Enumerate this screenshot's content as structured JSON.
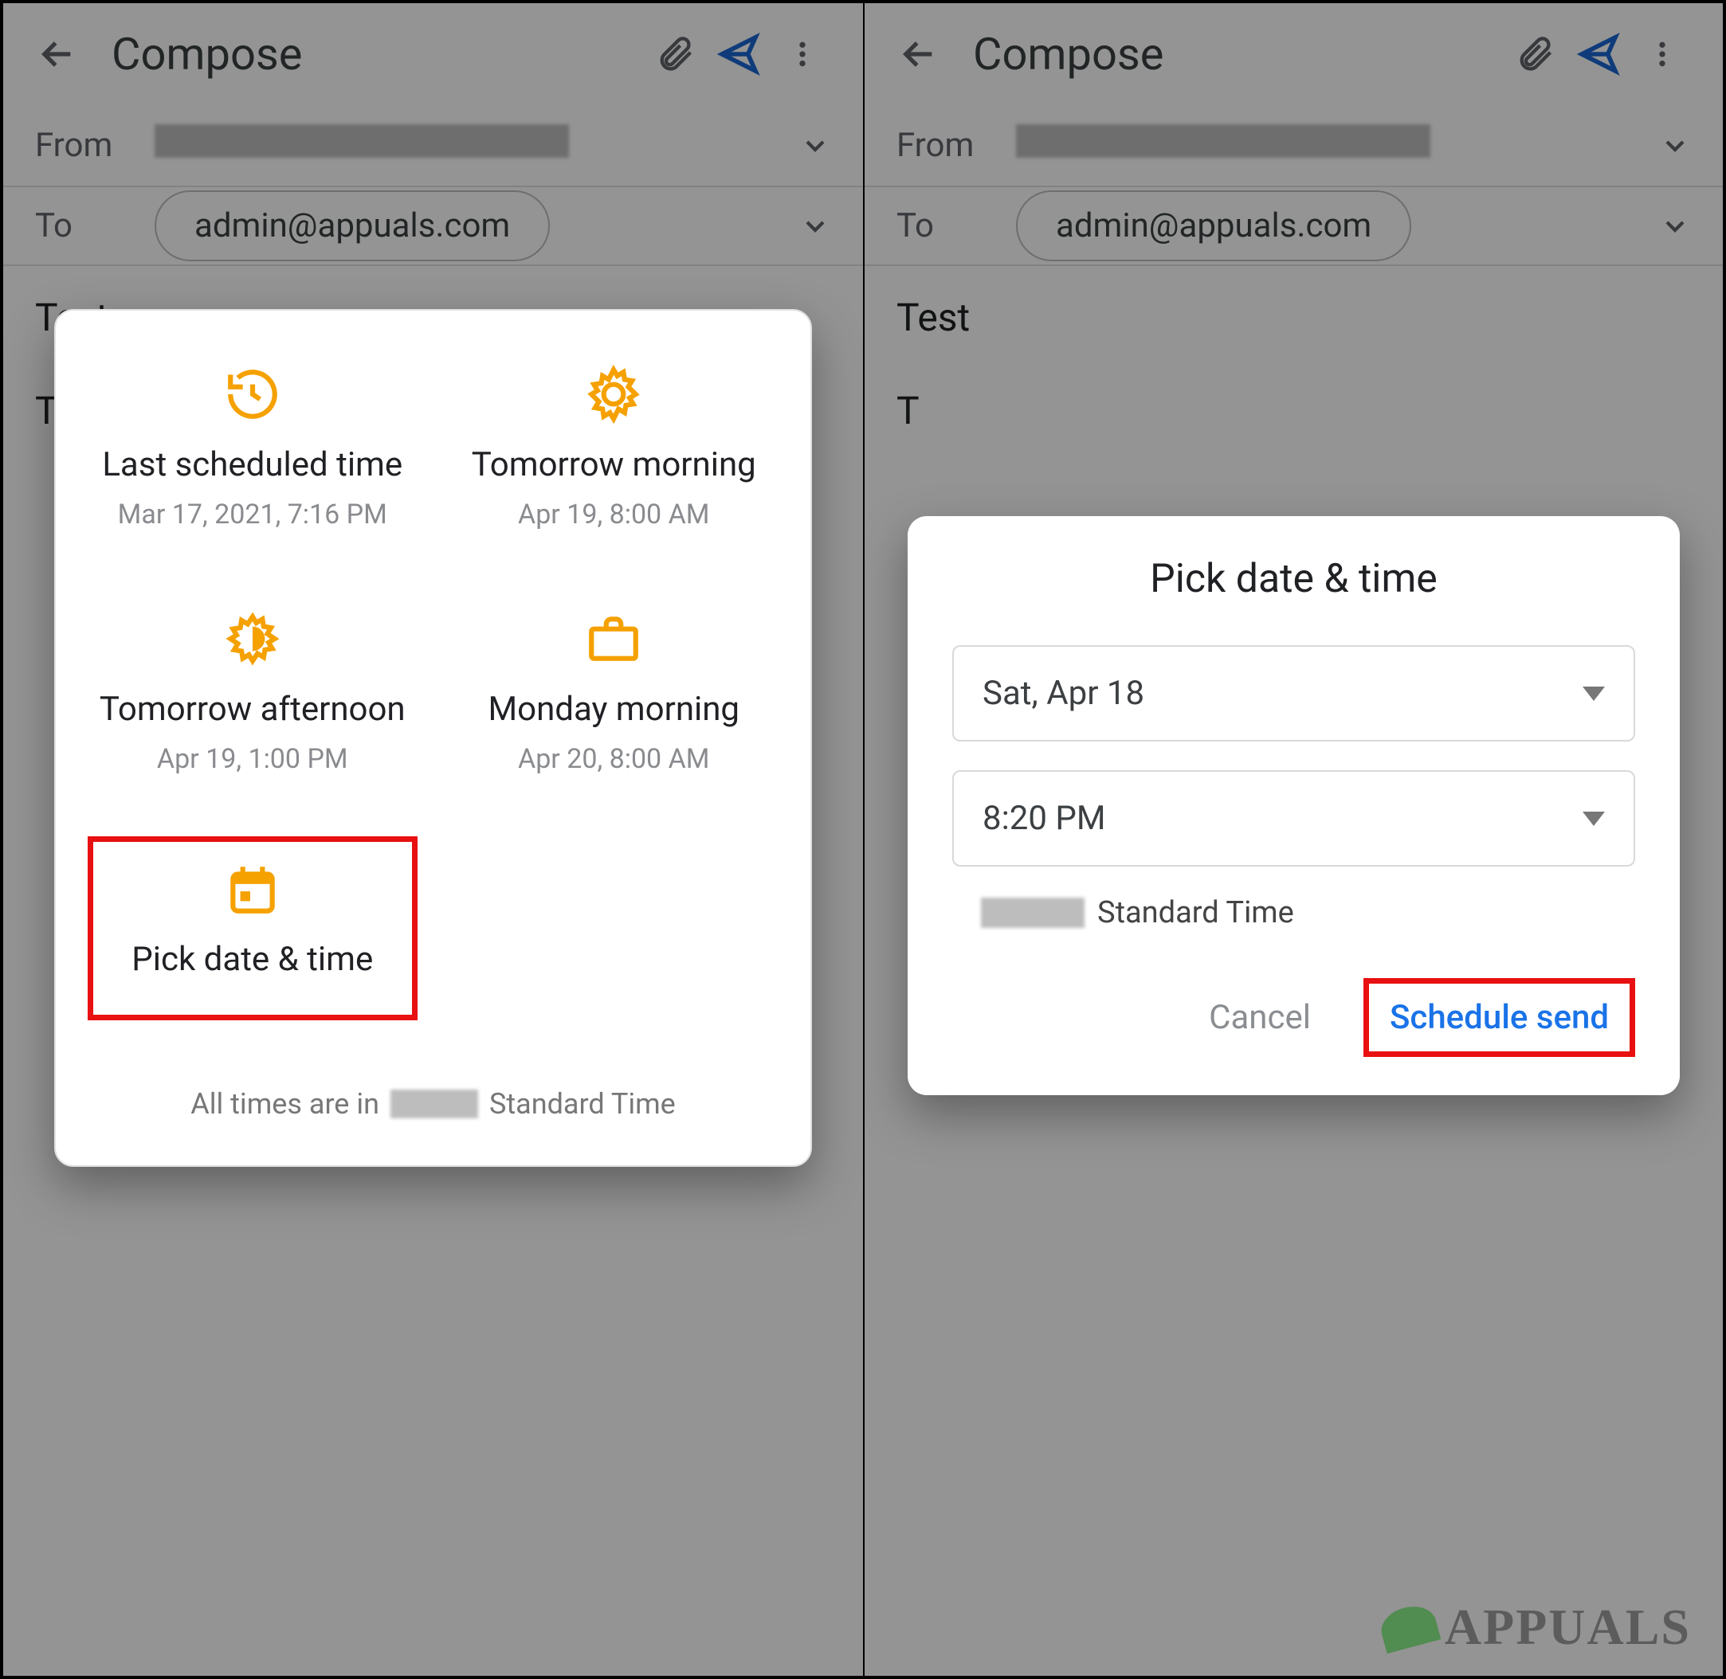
{
  "compose": {
    "title": "Compose",
    "from_label": "From",
    "to_label": "To",
    "to_address": "admin@appuals.com",
    "subject": "Test",
    "body_start": "T"
  },
  "schedule_options": {
    "items": [
      {
        "title": "Last scheduled time",
        "sub": "Mar 17, 2021, 7:16 PM",
        "icon": "history-clock"
      },
      {
        "title": "Tomorrow morning",
        "sub": "Apr 19, 8:00 AM",
        "icon": "sun-gear"
      },
      {
        "title": "Tomorrow afternoon",
        "sub": "Apr 19, 1:00 PM",
        "icon": "half-sun"
      },
      {
        "title": "Monday morning",
        "sub": "Apr 20, 8:00 AM",
        "icon": "briefcase"
      },
      {
        "title": "Pick date & time",
        "sub": "",
        "icon": "calendar",
        "highlight": true
      }
    ],
    "footer_prefix": "All times are in",
    "footer_suffix": "Standard Time"
  },
  "picker": {
    "title": "Pick date & time",
    "date": "Sat, Apr 18",
    "time": "8:20 PM",
    "tz_suffix": "Standard Time",
    "cancel": "Cancel",
    "confirm": "Schedule send"
  },
  "watermark": "APPUALS"
}
